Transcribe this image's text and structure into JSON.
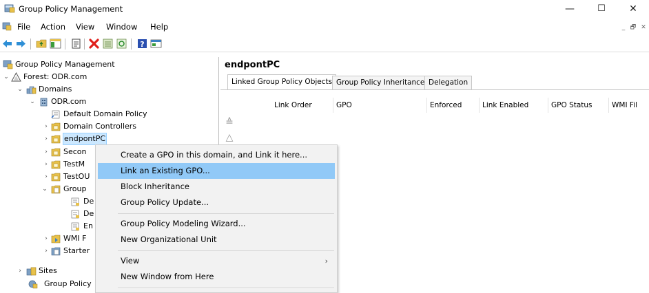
{
  "window": {
    "title": "Group Policy Management",
    "min_glyph": "—",
    "max_glyph": "☐",
    "close_glyph": "✕"
  },
  "menubar": {
    "items": [
      "File",
      "Action",
      "View",
      "Window",
      "Help"
    ],
    "mdi_min": "_",
    "mdi_restore": "🗗",
    "mdi_close": "✕"
  },
  "toolbar": {
    "icons": [
      "back-arrow-icon",
      "forward-arrow-icon",
      "up-folder-icon",
      "show-hide-tree-icon",
      "properties-icon",
      "delete-icon",
      "export-list-icon",
      "refresh-icon",
      "help-icon",
      "console-icon"
    ]
  },
  "tree": {
    "root": "Group Policy Management",
    "forest": "Forest: ODR.com",
    "domains": "Domains",
    "domain": "ODR.com",
    "default_domain_policy": "Default Domain Policy",
    "domain_controllers": "Domain Controllers",
    "endpointpc": "endpontPC",
    "secon": "Secon",
    "testm": "TestM",
    "testou": "TestOU",
    "group": "Group",
    "de1": "De",
    "de2": "De",
    "en": "En",
    "wmi": "WMI F",
    "starter": "Starter",
    "sites": "Sites",
    "group_policy": "Group Policy"
  },
  "right": {
    "header": "endpontPC",
    "tabs": [
      "Linked Group Policy Objects",
      "Group Policy Inheritance",
      "Delegation"
    ],
    "columns": [
      "Link Order",
      "GPO",
      "Enforced",
      "Link Enabled",
      "GPO Status",
      "WMI Fil"
    ]
  },
  "context_menu": {
    "items": [
      "Create a GPO in this domain, and Link it here...",
      "Link an Existing GPO...",
      "Block Inheritance",
      "Group Policy Update...",
      "Group Policy Modeling Wizard...",
      "New Organizational Unit",
      "View",
      "New Window from Here"
    ],
    "highlighted_index": 1,
    "submenu_arrow": "›"
  },
  "colors": {
    "menu_highlight": "#91c9f7",
    "tree_selection": "#cce8ff",
    "folder_yellow": "#e8c14a"
  }
}
